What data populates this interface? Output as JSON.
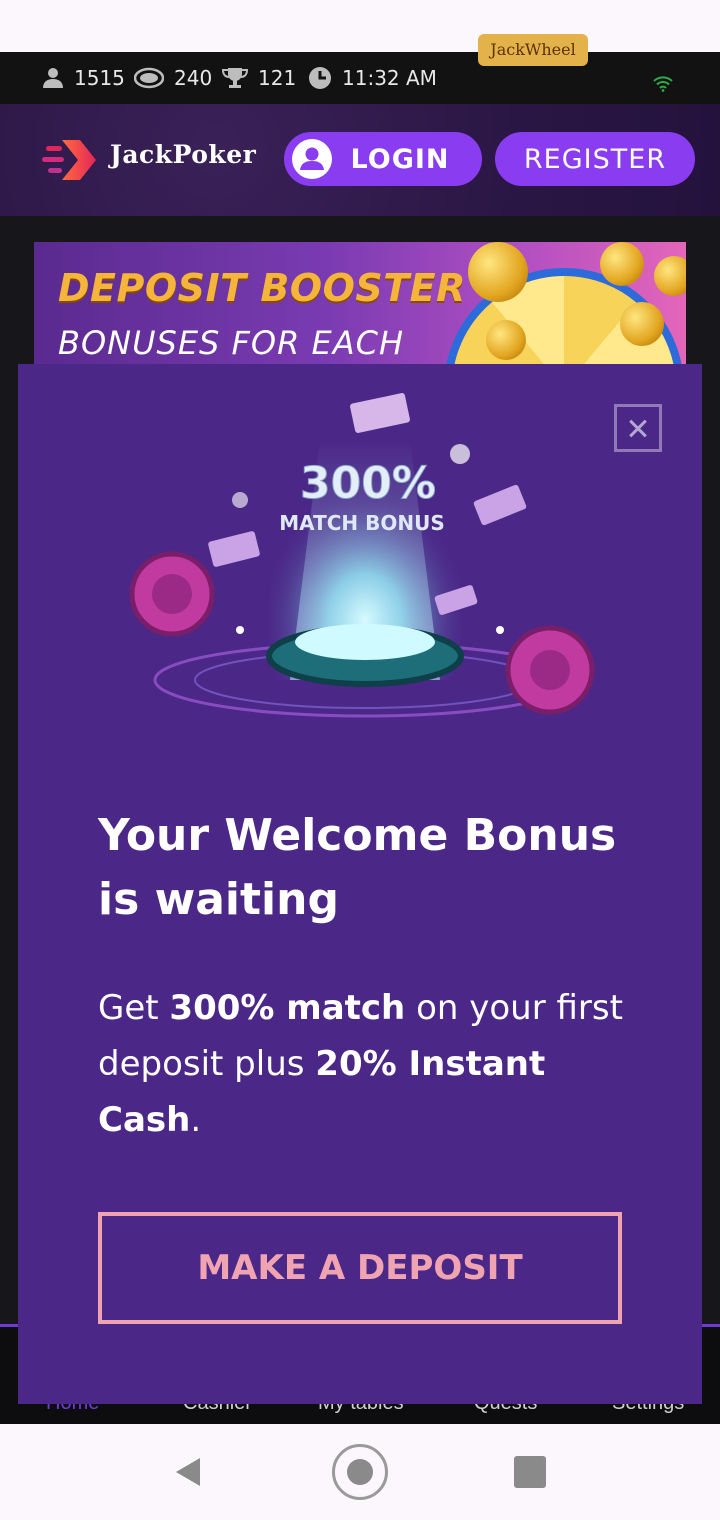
{
  "statusbar": {
    "players": "1515",
    "tables": "240",
    "tournaments": "121",
    "time": "11:32 AM"
  },
  "header": {
    "logo_text": "JackPoker",
    "login_label": "LOGIN",
    "register_label": "REGISTER"
  },
  "promo_banner": {
    "title": "DEPOSIT BOOSTER",
    "subtitle": "BONUSES FOR EACH",
    "wheel_label": "JackWheel"
  },
  "modal": {
    "hero_text_line1": "300%",
    "hero_text_line2": "MATCH BONUS",
    "title": "Your Welcome Bonus is waiting",
    "desc_part1": "Get ",
    "desc_bold1": "300% match",
    "desc_part2": " on your first deposit plus ",
    "desc_bold2": "20% Instant Cash",
    "desc_part3": ".",
    "cta_label": "MAKE A DEPOSIT"
  },
  "bottom_nav": {
    "items": [
      "Home",
      "Cashier",
      "My tables",
      "Quests",
      "Settings"
    ]
  },
  "colors": {
    "modal_bg": "#4b2888",
    "accent_purple": "#8a3cf0",
    "cta_pink": "#f0a4b2",
    "header_bg": "#2c1846"
  }
}
